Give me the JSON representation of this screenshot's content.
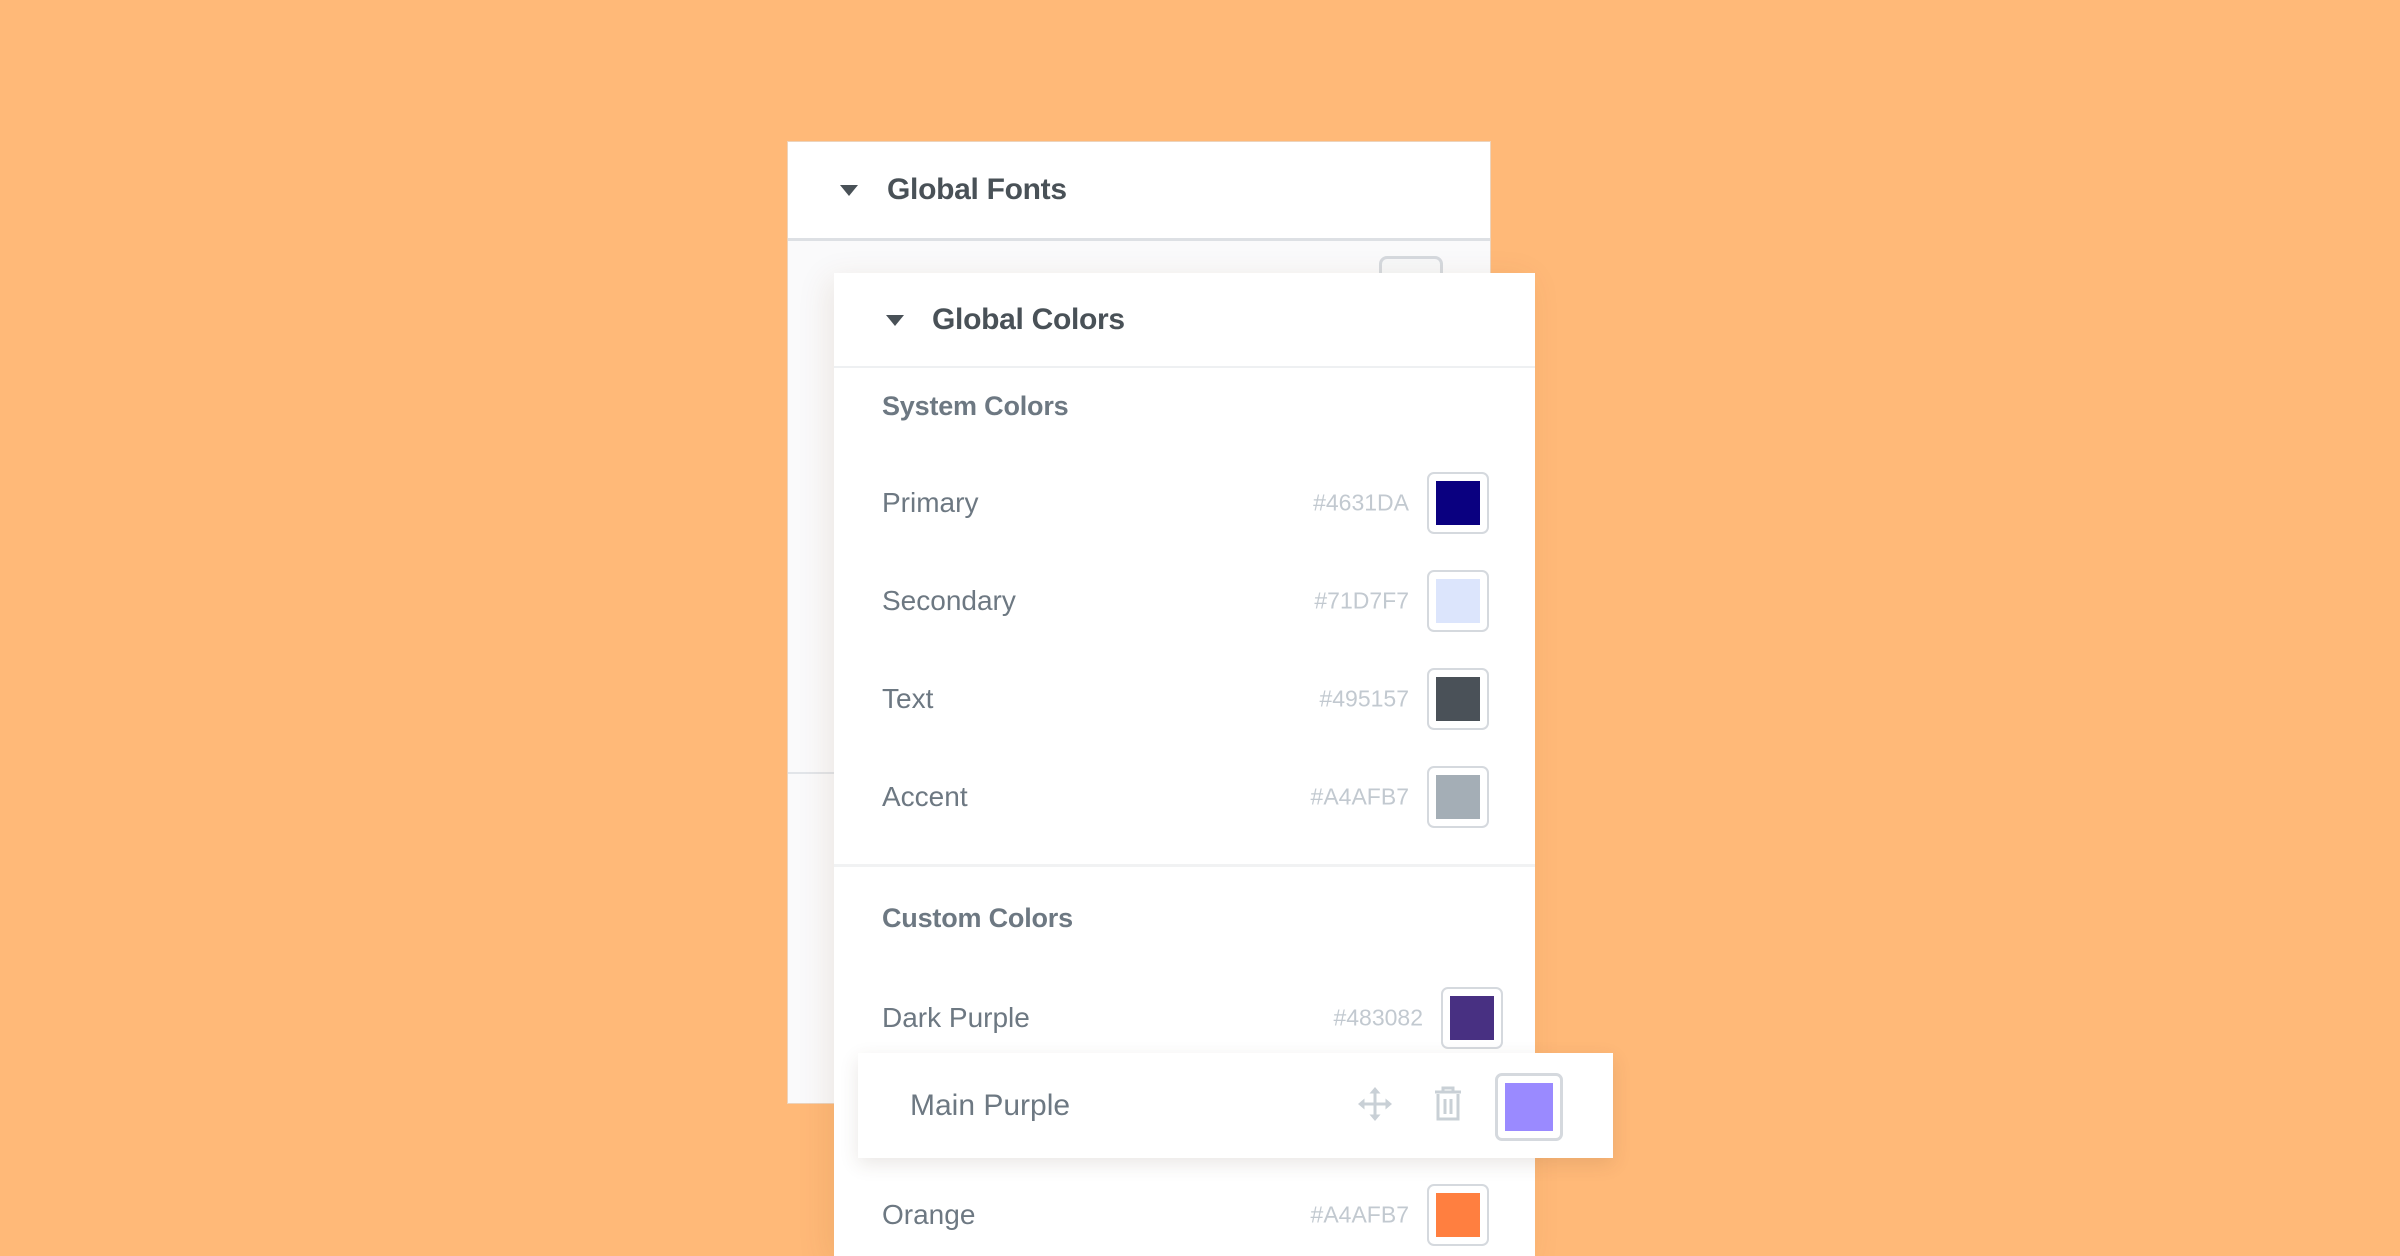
{
  "background_color": "#FFB978",
  "global_fonts": {
    "title": "Global Fonts",
    "expanded": true,
    "caret_icon": "caret-down-icon"
  },
  "global_colors": {
    "title": "Global Colors",
    "expanded": true,
    "caret_icon": "caret-down-icon",
    "system_colors": {
      "heading": "System Colors",
      "items": [
        {
          "name": "Primary",
          "hex": "#4631DA",
          "swatch": "#0A0080"
        },
        {
          "name": "Secondary",
          "hex": "#71D7F7",
          "swatch": "#DCE5FC"
        },
        {
          "name": "Text",
          "hex": "#495157",
          "swatch": "#4A5158"
        },
        {
          "name": "Accent",
          "hex": "#A4AFB7",
          "swatch": "#A4AEB6"
        }
      ]
    },
    "custom_colors": {
      "heading": "Custom Colors",
      "items": [
        {
          "name": "Dark Purple",
          "hex": "#483082",
          "swatch": "#483082"
        },
        {
          "name": "Main Purple",
          "hex": "",
          "swatch": "#9A8AFF",
          "dragging": true,
          "move_icon": "move-icon",
          "delete_icon": "trash-icon"
        },
        {
          "name": "Orange",
          "hex": "#A4AFB7",
          "swatch": "#FF7F40"
        }
      ]
    }
  }
}
